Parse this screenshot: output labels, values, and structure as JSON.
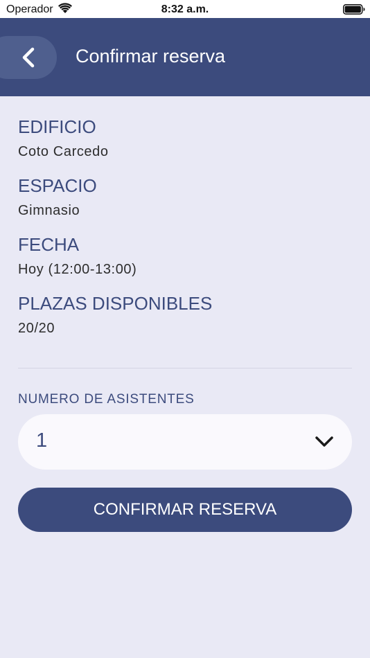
{
  "status_bar": {
    "carrier": "Operador",
    "time": "8:32 a.m."
  },
  "header": {
    "title": "Confirmar reserva"
  },
  "details": {
    "building": {
      "label": "EDIFICIO",
      "value": "Coto Carcedo"
    },
    "space": {
      "label": "ESPACIO",
      "value": "Gimnasio"
    },
    "date": {
      "label": "FECHA",
      "value": "Hoy (12:00-13:00)"
    },
    "seats": {
      "label": "PLAZAS DISPONIBLES",
      "value": "20/20"
    }
  },
  "attendees": {
    "label": "NUMERO DE ASISTENTES",
    "selected": "1"
  },
  "confirm_button": {
    "label": "CONFIRMAR RESERVA"
  },
  "colors": {
    "primary": "#3c4b7d",
    "background": "#e9e9f5",
    "input_background": "#faf9fd",
    "back_button": "#4f5f8e"
  },
  "icons": [
    "wifi-icon",
    "battery-icon",
    "chevron-left-icon",
    "chevron-down-icon"
  ]
}
